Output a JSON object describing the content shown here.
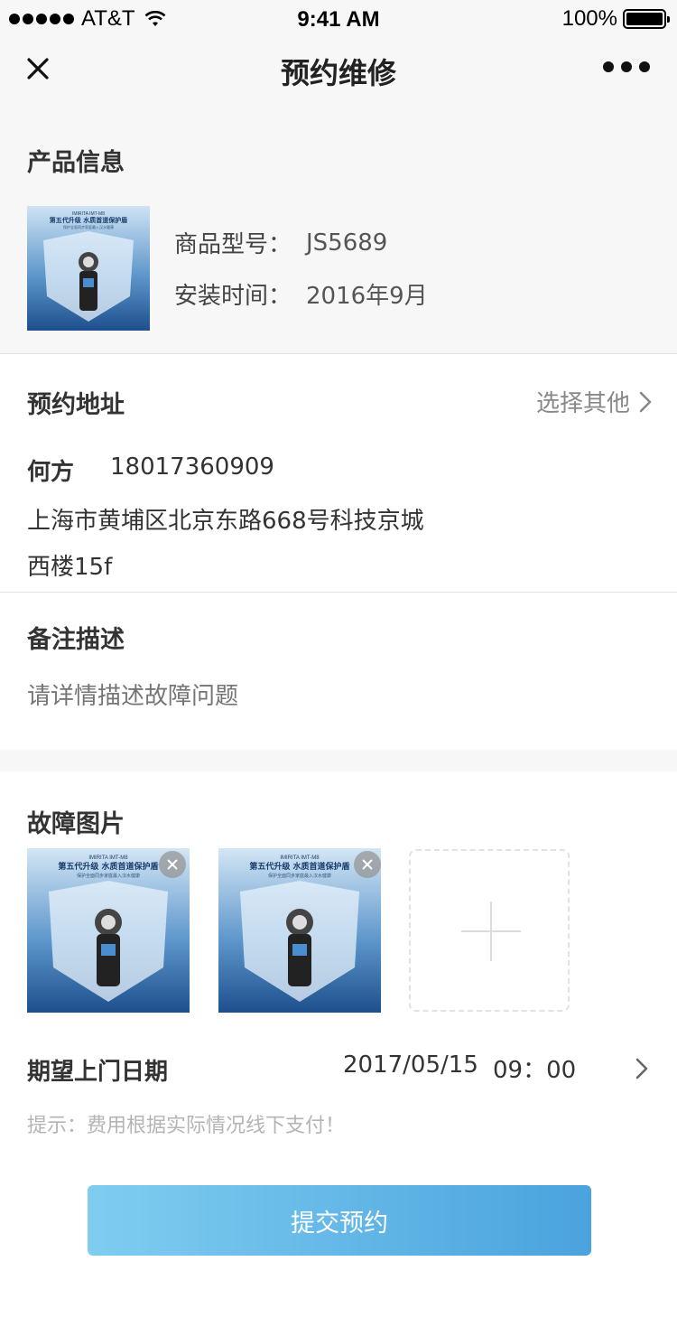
{
  "status_bar": {
    "carrier": "AT&T",
    "time": "9:41 AM",
    "battery": "100%"
  },
  "nav": {
    "title": "预约维修"
  },
  "product": {
    "section_title": "产品信息",
    "model_label": "商品型号：",
    "model_value": "JS5689",
    "install_label": "安装时间：",
    "install_value": "2016年9月",
    "image_text": {
      "brand": "IMIRITA IMT-M8",
      "headline": "第五代升级 水质首道保护盾",
      "sub": "保护全面同步家庭最入汉水健康"
    }
  },
  "address": {
    "section_title": "预约地址",
    "choose_other": "选择其他",
    "name": "何方",
    "phone": "18017360909",
    "detail": "上海市黄埔区北京东路668号科技京城西楼15f"
  },
  "remark": {
    "section_title": "备注描述",
    "placeholder": "请详情描述故障问题"
  },
  "photos": {
    "section_title": "故障图片"
  },
  "appointment": {
    "label": "期望上门日期",
    "date": "2017/05/15",
    "time": "09：00",
    "hint": "提示：费用根据实际情况线下支付！"
  },
  "submit_label": "提交预约",
  "colors": {
    "button_start": "#7fcdf0",
    "button_end": "#4aa3de",
    "background": "#f7f7f7"
  }
}
